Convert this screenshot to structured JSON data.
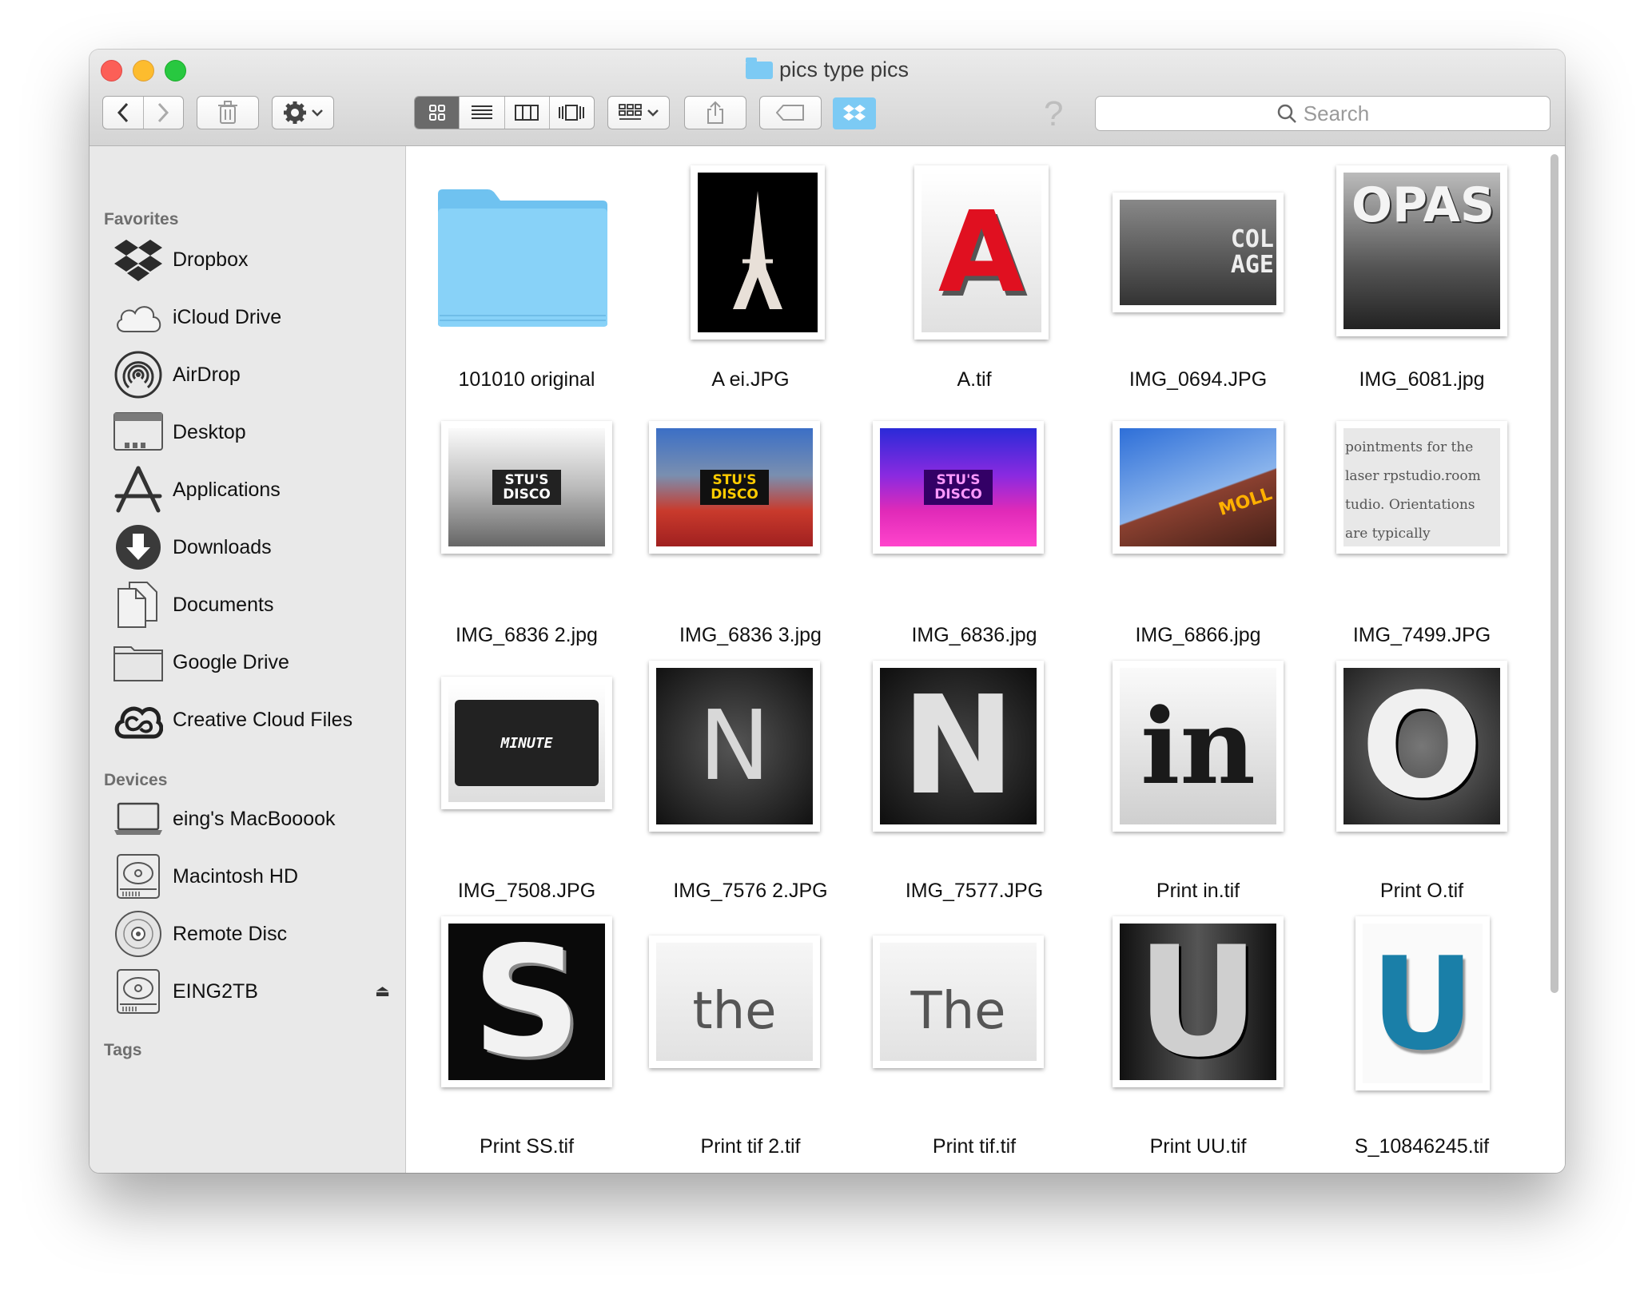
{
  "window": {
    "title": "pics type pics"
  },
  "toolbar": {
    "back_icon": "chevron-left-icon",
    "forward_icon": "chevron-right-icon",
    "search_placeholder": "Search",
    "help_glyph": "?"
  },
  "sidebar": {
    "favorites_heading": "Favorites",
    "favorites": [
      {
        "label": "Dropbox",
        "icon": "dropbox-icon"
      },
      {
        "label": "iCloud Drive",
        "icon": "cloud-icon"
      },
      {
        "label": "AirDrop",
        "icon": "airdrop-icon"
      },
      {
        "label": "Desktop",
        "icon": "desktop-icon"
      },
      {
        "label": "Applications",
        "icon": "applications-icon"
      },
      {
        "label": "Downloads",
        "icon": "download-icon"
      },
      {
        "label": "Documents",
        "icon": "documents-icon"
      },
      {
        "label": "Google Drive",
        "icon": "folder-icon"
      },
      {
        "label": "Creative Cloud Files",
        "icon": "creative-cloud-icon"
      }
    ],
    "devices_heading": "Devices",
    "devices": [
      {
        "label": "eing's MacBooook",
        "icon": "laptop-icon"
      },
      {
        "label": "Macintosh HD",
        "icon": "hard-drive-icon"
      },
      {
        "label": "Remote Disc",
        "icon": "disc-icon"
      },
      {
        "label": "EING2TB",
        "icon": "external-drive-icon"
      }
    ],
    "tags_heading": "Tags"
  },
  "files": [
    {
      "name": "101010 original",
      "kind": "folder"
    },
    {
      "name": "A ei.JPG",
      "thumb_text": ""
    },
    {
      "name": "A.tif",
      "thumb_text": "A"
    },
    {
      "name": "IMG_0694.JPG",
      "thumb_text": "COL AGE"
    },
    {
      "name": "IMG_6081.jpg",
      "thumb_text": "OPAS"
    },
    {
      "name": "IMG_6836 2.jpg",
      "thumb_text": "STU'S DISCO"
    },
    {
      "name": "IMG_6836 3.jpg",
      "thumb_text": "STU'S DISCO"
    },
    {
      "name": "IMG_6836.jpg",
      "thumb_text": "STU'S DISCO"
    },
    {
      "name": "IMG_6866.jpg",
      "thumb_text": "MOLL"
    },
    {
      "name": "IMG_7499.JPG",
      "thumb_text": "pointments for the laser rpstudio.room tudio. Orientations are typically"
    },
    {
      "name": "IMG_7508.JPG",
      "thumb_text": "MINUTE"
    },
    {
      "name": "IMG_7576 2.JPG",
      "thumb_text": "N"
    },
    {
      "name": "IMG_7577.JPG",
      "thumb_text": "N"
    },
    {
      "name": "Print in.tif",
      "thumb_text": "in"
    },
    {
      "name": "Print O.tif",
      "thumb_text": "O"
    },
    {
      "name": "Print SS.tif",
      "thumb_text": "S"
    },
    {
      "name": "Print tif 2.tif",
      "thumb_text": "the"
    },
    {
      "name": "Print tif.tif",
      "thumb_text": "The"
    },
    {
      "name": "Print UU.tif",
      "thumb_text": "U"
    },
    {
      "name": "S_10846245.tif",
      "thumb_text": "U"
    }
  ]
}
